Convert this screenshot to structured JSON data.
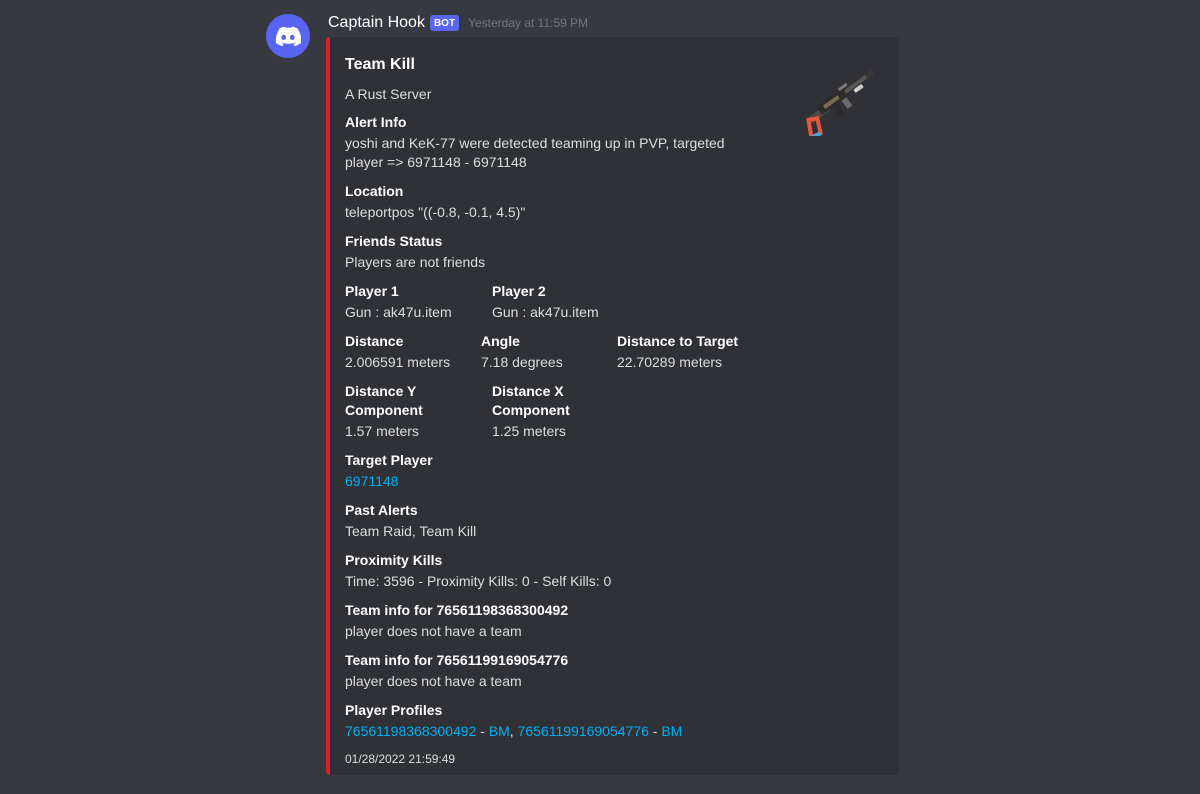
{
  "author": {
    "name": "Captain Hook",
    "tag": "BOT",
    "timestamp": "Yesterday at 11:59 PM"
  },
  "embed": {
    "title": "Team Kill",
    "description": "A Rust Server",
    "accent_color": "#e01b24",
    "thumbnail_icon": "ak47u-rifle-icon",
    "fields": {
      "alert_info": {
        "name": "Alert Info",
        "value": "yoshi and KeK-77 were detected teaming up in PVP, targeted player => 6971148 - 6971148"
      },
      "location": {
        "name": "Location",
        "value": "teleportpos \"((-0.8, -0.1, 4.5)\""
      },
      "friends_status": {
        "name": "Friends Status",
        "value": "Players are not friends"
      },
      "player1": {
        "name": "Player 1",
        "value": "Gun : ak47u.item"
      },
      "player2": {
        "name": "Player 2",
        "value": "Gun : ak47u.item"
      },
      "distance": {
        "name": "Distance",
        "value": "2.006591 meters"
      },
      "angle": {
        "name": "Angle",
        "value": "7.18 degrees"
      },
      "distance_to_target": {
        "name": "Distance to Target",
        "value": "22.70289 meters"
      },
      "distance_y": {
        "name": "Distance Y Component",
        "value": "1.57 meters"
      },
      "distance_x": {
        "name": "Distance X Component",
        "value": "1.25 meters"
      },
      "target_player": {
        "name": "Target Player",
        "value": "6971148"
      },
      "past_alerts": {
        "name": "Past Alerts",
        "value": "Team Raid, Team Kill"
      },
      "proximity_kills": {
        "name": "Proximity Kills",
        "value": "Time: 3596 - Proximity Kills: 0 - Self Kills: 0"
      },
      "team_info_1": {
        "name": "Team info for 76561198368300492",
        "value": "player does not have a team"
      },
      "team_info_2": {
        "name": "Team info for 76561199169054776",
        "value": "player does not have a team"
      },
      "player_profiles": {
        "name": "Player Profiles",
        "profile1": "76561198368300492",
        "sep1": " - ",
        "bm1": "BM",
        "comma": ", ",
        "profile2": "76561199169054776",
        "sep2": " - ",
        "bm2": "BM"
      }
    },
    "footer": "01/28/2022 21:59:49"
  }
}
